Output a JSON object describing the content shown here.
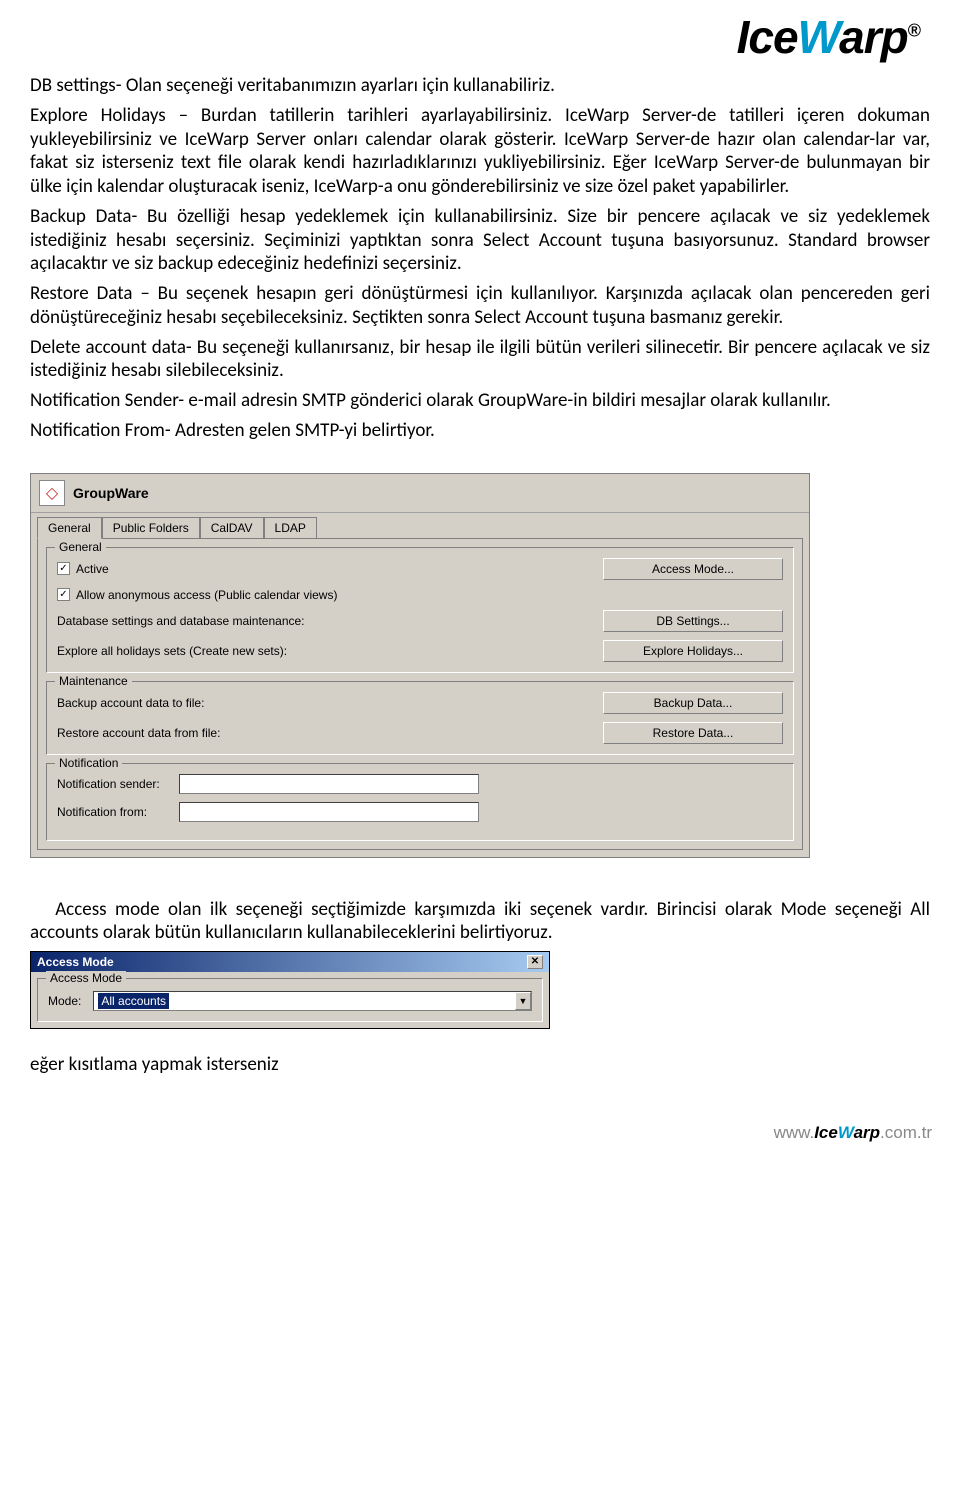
{
  "logo": {
    "part1": "Ice",
    "part2": "W",
    "part3": "arp",
    "reg": "®"
  },
  "paragraphs": {
    "p1": "DB settings- Olan seçeneği veritabanımızın ayarları için kullanabiliriz.",
    "p2": "Explore Holidays – Burdan tatillerin tarihleri ayarlayabilirsiniz. IceWarp Server-de tatilleri içeren dokuman yukleyebilirsiniz ve IceWarp Server onları calendar olarak gösterir. IceWarp Server-de hazır olan calendar-lar var, fakat siz isterseniz text file olarak kendi hazırladıklarınızı yukliyebilirsiniz. Eğer IceWarp Server-de bulunmayan bir ülke için kalendar oluşturacak iseniz, IceWarp-a onu gönderebilirsiniz ve size özel paket yapabilirler.",
    "p3": "Backup Data- Bu özelliği hesap yedeklemek için kullanabilirsiniz. Size bir pencere açılacak ve siz yedeklemek istediğiniz hesabı seçersiniz. Seçiminizi yaptıktan sonra Select Account tuşuna basıyorsunuz. Standard browser açılacaktır ve siz backup edeceğiniz hedefinizi seçersiniz.",
    "p4": "Restore Data – Bu seçenek hesapın geri dönüştürmesi için kullanılıyor. Karşınızda açılacak olan pencereden geri dönüştüreceğiniz hesabı seçebileceksiniz. Seçtikten sonra Select Account tuşuna basmanız gerekir.",
    "p5": "Delete account data- Bu seçeneği kullanırsanız, bir hesap ile ilgili bütün verileri silinecetir. Bir pencere açılacak ve siz istediğiniz hesabı silebileceksiniz.",
    "p6": "Notification Sender- e-mail adresin SMTP gönderici olarak GroupWare-in bildiri mesajlar olarak kullanılır.",
    "p7": "Notification From- Adresten gelen SMTP-yi belirtiyor."
  },
  "groupware": {
    "title": "GroupWare",
    "tabs": {
      "general": "General",
      "publicFolders": "Public Folders",
      "caldav": "CalDAV",
      "ldap": "LDAP"
    },
    "sections": {
      "general": {
        "legend": "General",
        "active": "Active",
        "allowAnon": "Allow anonymous access (Public calendar views)",
        "dbSettingsLabel": "Database settings and database maintenance:",
        "exploreLabel": "Explore all holidays sets (Create new sets):",
        "btnAccessMode": "Access Mode...",
        "btnDbSettings": "DB Settings...",
        "btnExplore": "Explore Holidays..."
      },
      "maintenance": {
        "legend": "Maintenance",
        "backupLabel": "Backup account data to file:",
        "restoreLabel": "Restore account data from file:",
        "btnBackup": "Backup Data...",
        "btnRestore": "Restore Data..."
      },
      "notification": {
        "legend": "Notification",
        "senderLabel": "Notification sender:",
        "fromLabel": "Notification from:"
      }
    }
  },
  "accessModeText": "   Access mode olan ilk seçeneği seçtiğimizde karşımızda iki seçenek vardır. Birincisi olarak Mode seçeneği All accounts olarak bütün kullanıcıların kullanabileceklerini belirtiyoruz.",
  "accessDialog": {
    "title": "Access Mode",
    "legend": "Access Mode",
    "modeLabel": "Mode:",
    "modeValue": "All accounts"
  },
  "trailing": "eğer kısıtlama yapmak isterseniz",
  "footer": {
    "pre": "www.",
    "ice": "Ice",
    "w": "W",
    "arp": "arp",
    "suffix": ".com.tr"
  }
}
